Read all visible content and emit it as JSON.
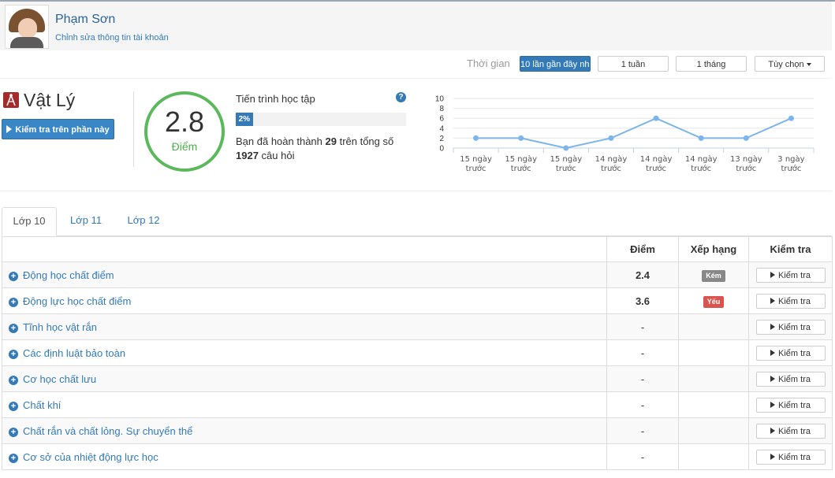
{
  "profile": {
    "name": "Phạm Sơn",
    "edit_link": "Chỉnh sửa thông tin tài khoản"
  },
  "filter": {
    "label": "Thời gian",
    "options": [
      {
        "label": "10 lần gần đây nhất",
        "active": true
      },
      {
        "label": "1 tuần",
        "active": false
      },
      {
        "label": "1 tháng",
        "active": false
      },
      {
        "label": "Tùy chọn",
        "active": false,
        "dropdown": true
      }
    ]
  },
  "subject": {
    "title": "Vật Lý",
    "icon": "compass-icon",
    "test_button": "Kiểm tra trên phần này"
  },
  "score": {
    "value": "2.8",
    "label": "Điểm",
    "ring_color": "#5cb85c"
  },
  "progress": {
    "title": "Tiến trình học tập",
    "percent": 2,
    "percent_label": "2%",
    "text_prefix": "Bạn đã hoàn thành ",
    "completed": "29",
    "text_middle": " trên tổng số ",
    "total": "1927",
    "text_suffix": " câu hỏi"
  },
  "chart_data": {
    "type": "line",
    "x": [
      "15 ngày trước",
      "15 ngày trước",
      "15 ngày trước",
      "14 ngày trước",
      "14 ngày trước",
      "14 ngày trước",
      "13 ngày trước",
      "3 ngày trước"
    ],
    "y": [
      2,
      2,
      0,
      2,
      6,
      2,
      2,
      6
    ],
    "ylim": [
      0,
      10
    ],
    "yticks": [
      0,
      2,
      4,
      6,
      8,
      10
    ],
    "grid": true,
    "color": "#7cb5ec"
  },
  "tabs": [
    {
      "label": "Lớp 10",
      "active": true
    },
    {
      "label": "Lớp 11",
      "active": false
    },
    {
      "label": "Lớp 12",
      "active": false
    }
  ],
  "table": {
    "headers": {
      "topic": "",
      "score": "Điểm",
      "rank": "Xếp hạng",
      "test": "Kiểm tra"
    },
    "button_label": "Kiểm tra",
    "rows": [
      {
        "topic": "Động học chất điểm",
        "score": "2.4",
        "rank": "Kém",
        "rank_color": "#888888"
      },
      {
        "topic": "Động lực học chất điểm",
        "score": "3.6",
        "rank": "Yếu",
        "rank_color": "#d9534f"
      },
      {
        "topic": "Tĩnh học vật rắn",
        "score": "-",
        "rank": "",
        "rank_color": ""
      },
      {
        "topic": "Các định luật bảo toàn",
        "score": "-",
        "rank": "",
        "rank_color": ""
      },
      {
        "topic": "Cơ học chất lưu",
        "score": "-",
        "rank": "",
        "rank_color": ""
      },
      {
        "topic": "Chất khí",
        "score": "-",
        "rank": "",
        "rank_color": ""
      },
      {
        "topic": "Chất rắn và chất lỏng. Sự chuyển thể",
        "score": "-",
        "rank": "",
        "rank_color": ""
      },
      {
        "topic": "Cơ sở của nhiệt động lực học",
        "score": "-",
        "rank": "",
        "rank_color": ""
      }
    ]
  }
}
